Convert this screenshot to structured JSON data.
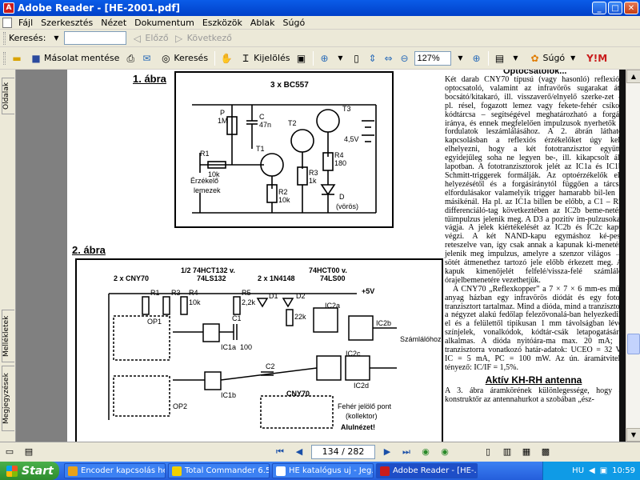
{
  "window": {
    "title": "Adobe Reader - [HE-2001.pdf]",
    "app_badge": "A"
  },
  "menu": [
    "Fájl",
    "Szerkesztés",
    "Nézet",
    "Dokumentum",
    "Eszközök",
    "Ablak",
    "Súgó"
  ],
  "toolbar1": {
    "search_label": "Keresés:",
    "search_value": "",
    "prev_label": "Előző",
    "next_label": "Következő"
  },
  "toolbar2": {
    "save_copy_label": "Másolat mentése",
    "search_label": "Keresés",
    "select_label": "Kijelölés",
    "zoom_value": "127%",
    "help_label": "Súgó"
  },
  "sidetabs": [
    "Oldalak",
    "Mellékletek",
    "Megjegyzések"
  ],
  "page": {
    "top_snippet": "Optocsatolók...",
    "fig1_heading": "1. ábra",
    "fig2_heading": "2. ábra",
    "fig1_labels": [
      "3 x BC557",
      "P",
      "1M",
      "C",
      "47n",
      "T1",
      "T2",
      "T3",
      "R1",
      "10k",
      "R2",
      "10k",
      "R3",
      "1k",
      "R4",
      "180",
      "4,5V",
      "D",
      "(vörös)",
      "Érzékelő",
      "lemezek"
    ],
    "fig2_labels": [
      "2 x CNY70",
      "1/2 74HCT132 v.",
      "74LS132",
      "2 x 1N4148",
      "74HCT00 v.",
      "74LS00",
      "+5V",
      "R1",
      "R3",
      "R4",
      "R5",
      "10k",
      "2,2k",
      "22k",
      "OP1",
      "OP2",
      "IC1a",
      "IC1b",
      "IC2a",
      "IC2b",
      "IC2c",
      "IC2d",
      "D1",
      "D2",
      "C1",
      "C2",
      "100",
      "Számlálóhoz",
      "CNY70",
      "Fehér jelölő pont",
      "(kollektor)",
      "Alulnézet!"
    ],
    "article_paragraphs": [
      "Két darab CNY70 típusú (vagy hasonló) reflexiós optocsatoló, valamint az infravörös sugarakat át-bocsátó/kitakaró, ill. visszaverő/elnyelő szerke-zet – pl. résel, fogazott lemez vagy fekete-fehér csíkos kódtárcsa – segítségével meghatározható a forgás iránya, és ennek megfelelően impulzusok nyerhetők a fordulatok leszámlálásához. A 2. ábrán látható kapcsolásban a reflexiós érzékelőket úgy kell elhelyezni, hogy a két fototranzisztor együtt, egyidejűleg soha ne legyen be-, ill. kikapcsolt ál-lapotban. A fototranzisztorok jelét az IC1a és IC1b Schmitt-triggerek formálják. Az optoérzékelők el-helyezésétől és a forgásiránytól függően a tárcsa elfordulásakor valamelyik trigger hamarabb bil-len a másikénál. Ha pl. az IC1a billen be előbb, a C1 – R5 differenciáló-tag következtében az IC2b beme-netén tűimpulzus jelenik meg. A D3 a pozitív im-pulzusokat vágja. A jelek kiértékelését az IC2b és IC2c kapu végzi. A két NAND-kapu egymáshoz ké-pest reteszelve van, így csak annak a kapunak ki-menetén jelenik meg impulzus, amelyre a szenzor világos → sötét átmenethez tartozó jele előbb érkezett meg. A kapuk kimenőjelét felfelé/vissza-felé számláló órajelbemenetére vezethetjük.",
      "A CNY70 „Reflexkopper” a 7 × 7 × 6 mm-es mű-anyag házban egy infravörös diódát és egy foto-tranzisztort tartalmaz. Mind a dióda, mind a tranzisztor a négyzet alakú fedőlap felezővonalá-ban helyezkedik el és a felülettől tipikusan 1 mm távolságban lévő színjelek, vonalkódok, kódtár-csák letapogatására alkalmas. A dióda nyitóára-ma max. 20 mA; a tranzisztorra vonatkozó határ-adatok: UCEO = 32 V, IC = 5 mA, PC = 100 mW. Az ún. áramátviteli tényező: IC/IF = 1,5%.",
      "A 3. ábra áramkörének különlegessége, hogy a konstruktőr az antennahurkot a szobában „ész-"
    ],
    "article_heading": "Aktív KH-RH antenna"
  },
  "navbar": {
    "page_indicator": "134 / 282"
  },
  "taskbar": {
    "start_label": "Start",
    "tasks": [
      {
        "label": "Encoder kapcsolás he...",
        "color": "#e8a21a"
      },
      {
        "label": "Total Commander 6.5...",
        "color": "#f0d000"
      },
      {
        "label": "HE katalógus uj - Jeg...",
        "color": "#ffffff"
      },
      {
        "label": "Adobe Reader - [HE-...",
        "color": "#c91c1c"
      }
    ],
    "lang": "HU",
    "clock": "10:59"
  }
}
